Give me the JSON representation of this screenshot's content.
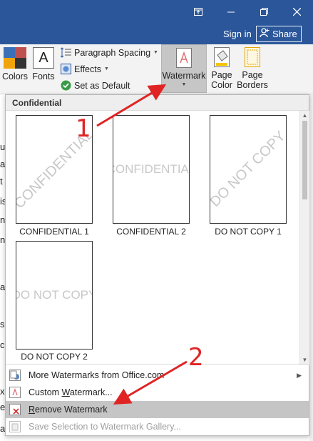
{
  "titlebar": {
    "signin": "Sign in",
    "share": "Share",
    "bg_color": "#2b579a"
  },
  "ribbon": {
    "colors_label": "Colors",
    "fonts_label": "Fonts",
    "fonts_glyph": "A",
    "paragraph_spacing": "Paragraph Spacing",
    "effects": "Effects",
    "set_as_default": "Set as Default",
    "watermark_label": "Watermark",
    "page_color_label_1": "Page",
    "page_color_label_2": "Color",
    "page_borders_label_1": "Page",
    "page_borders_label_2": "Borders"
  },
  "doc_chars": [
    "u",
    "a",
    "t",
    "is",
    "n",
    "n",
    "a",
    "s",
    "c",
    "x",
    "e",
    "a"
  ],
  "dropdown": {
    "section": "Confidential",
    "thumbnails": [
      {
        "label": "CONFIDENTIAL 1",
        "text": "CONFIDENTIAL",
        "style": "diagonal"
      },
      {
        "label": "CONFIDENTIAL 2",
        "text": "CONFIDENTIAL",
        "style": "horizontal"
      },
      {
        "label": "DO NOT COPY 1",
        "text": "DO NOT COPY",
        "style": "diagonal"
      },
      {
        "label": "DO NOT COPY 2",
        "text": "DO NOT COPY",
        "style": "horizontal"
      }
    ],
    "menu": {
      "more_watermarks_pre": "More Watermarks from Office.com",
      "custom_pre": "Custom ",
      "custom_u": "W",
      "custom_post": "atermark...",
      "remove_u": "R",
      "remove_post": "emove Watermark",
      "save_selection": "Save Selection to Watermark Gallery..."
    }
  },
  "annotations": {
    "step1": "1",
    "step2": "2",
    "color": "#e02424"
  },
  "icons": [
    "restore-ribbon-icon",
    "minimize-icon",
    "restore-icon",
    "close-icon",
    "share-person-icon",
    "paragraph-spacing-icon",
    "effects-icon",
    "checkmark-icon",
    "watermark-icon",
    "page-color-icon",
    "page-borders-icon",
    "chevron-down-icon",
    "globe-icon",
    "custom-watermark-icon",
    "remove-watermark-icon",
    "save-gallery-icon",
    "submenu-arrow-icon"
  ]
}
